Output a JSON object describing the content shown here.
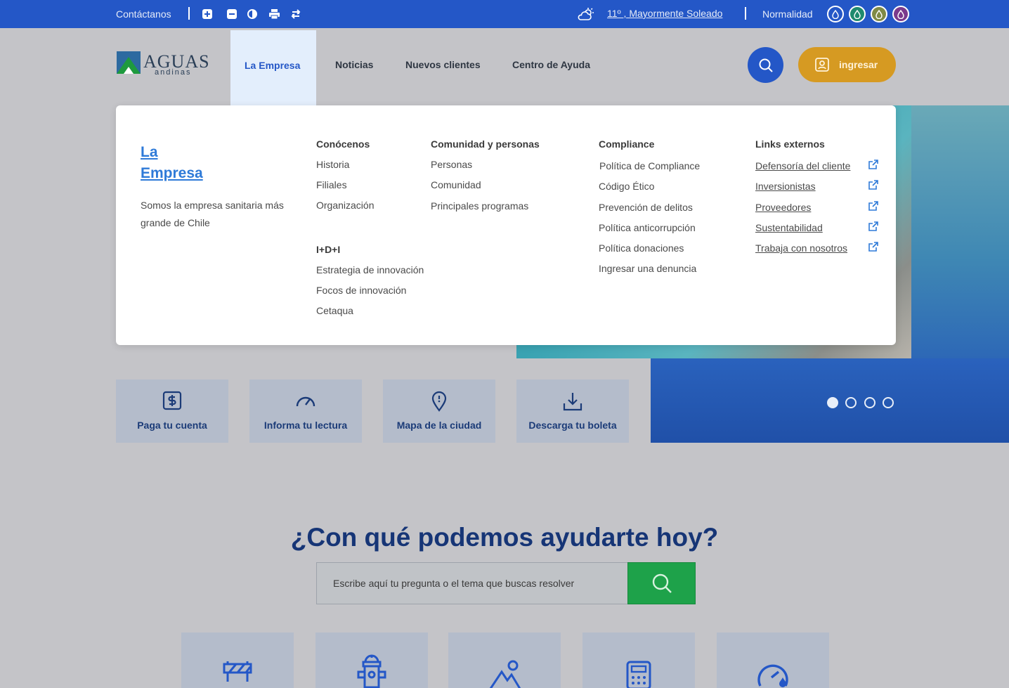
{
  "topbar": {
    "contact": "Contáctanos",
    "weather": "11º , Mayormente Soleado",
    "status": "Normalidad",
    "tools": [
      "zoom-in-icon",
      "zoom-out-icon",
      "contrast-icon",
      "print-icon",
      "reset-icon"
    ],
    "drop_colors": [
      "#2457c7",
      "#1f8a6e",
      "#7f8a46",
      "#7b3a8c"
    ]
  },
  "header": {
    "logo_word": "AGUAS",
    "logo_sub": "andinas",
    "nav": [
      "La Empresa",
      "Noticias",
      "Nuevos clientes",
      "Centro de Ayuda"
    ],
    "login": "ingresar"
  },
  "mega": {
    "title_line1": "La",
    "title_line2": "Empresa",
    "description": "Somos la empresa sanitaria más grande de Chile",
    "conocenos": {
      "heading": "Conócenos",
      "items": [
        "Historia",
        "Filiales",
        "Organización"
      ]
    },
    "idi": {
      "heading": "I+D+I",
      "items": [
        "Estrategia de innovación",
        "Focos de innovación",
        "Cetaqua"
      ]
    },
    "comunidad": {
      "heading": "Comunidad y personas",
      "items": [
        "Personas",
        "Comunidad",
        "Principales programas"
      ]
    },
    "compliance": {
      "heading": "Compliance",
      "items": [
        "Política de Compliance",
        "Código Ético",
        "Prevención de delitos",
        "Política anticorrupción",
        "Política donaciones",
        "Ingresar una denuncia"
      ]
    },
    "externos": {
      "heading": "Links externos",
      "items": [
        "Defensoría del cliente",
        "Inversionistas",
        "Proveedores",
        "Sustentabilidad",
        "Trabaja con nosotros"
      ]
    }
  },
  "quick_actions": [
    "Paga tu cuenta",
    "Informa tu lectura",
    "Mapa de la ciudad",
    "Descarga tu boleta"
  ],
  "carousel": {
    "slides": 4,
    "active": 1
  },
  "help": {
    "title": "¿Con qué podemos ayudarte hoy?",
    "placeholder": "Escribe aquí tu pregunta o el tema que buscas resolver"
  },
  "colors": {
    "primary": "#2457c7",
    "accent": "#d69a22",
    "success": "#1ea24a",
    "navy": "#163576"
  }
}
